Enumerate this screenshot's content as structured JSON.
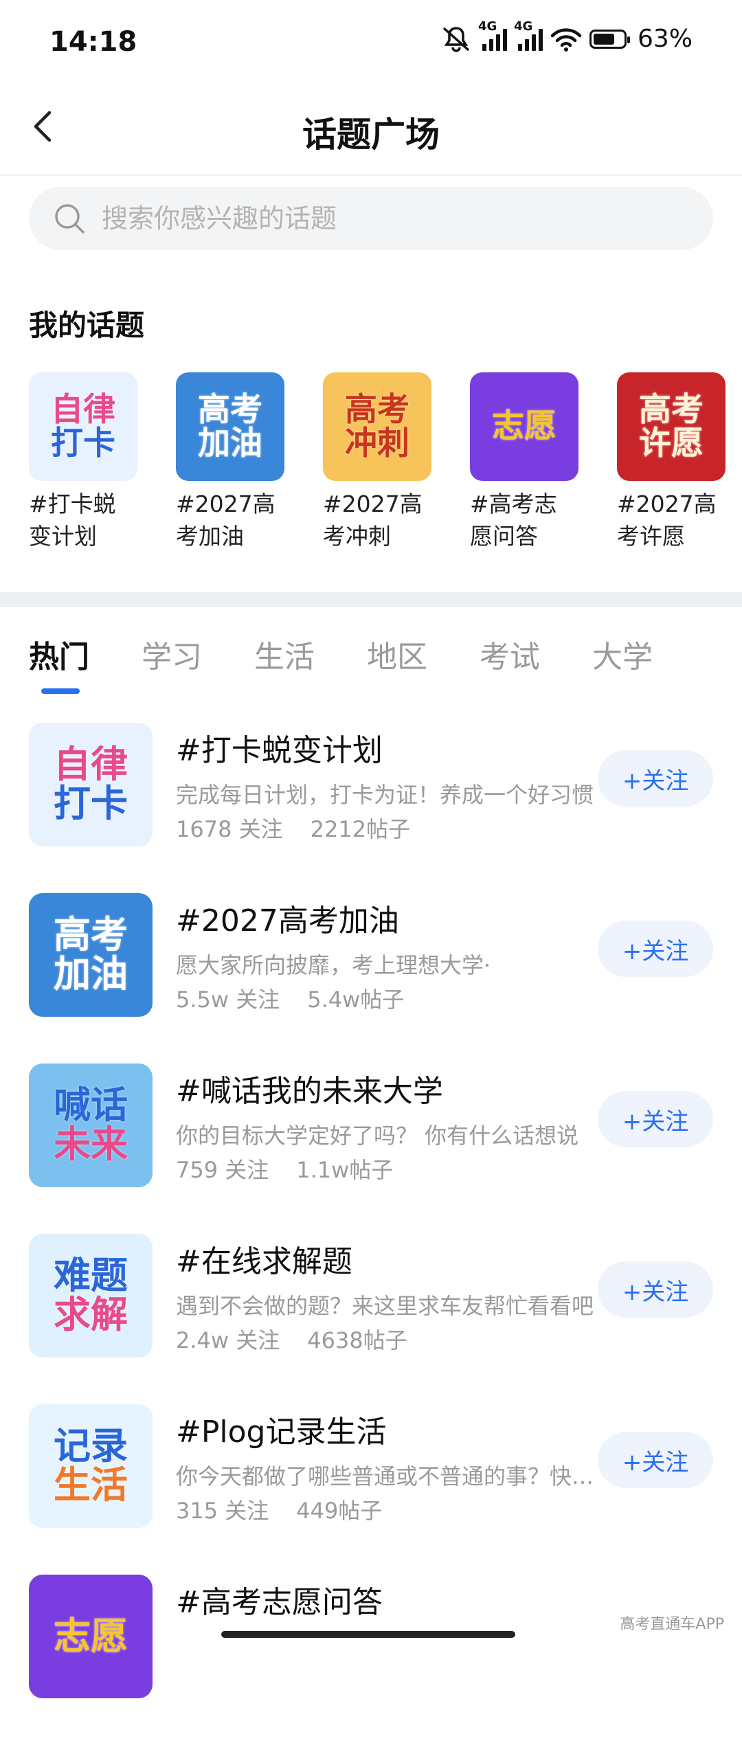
{
  "status_bar": {
    "time": "14:18",
    "network1": "4G",
    "network2": "4G",
    "battery": "63%"
  },
  "header": {
    "title": "话题广场"
  },
  "search": {
    "placeholder": "搜索你感兴趣的话题"
  },
  "my_topics": {
    "title": "我的话题",
    "items": [
      {
        "label": "#打卡蜕变计划",
        "art_lines": [
          "自律",
          "打卡"
        ],
        "bg": "#e8f2ff",
        "fg1": "#e84a8a",
        "fg2": "#2a66d8"
      },
      {
        "label": "#2027高考加油",
        "art_lines": [
          "高考",
          "加油"
        ],
        "bg": "#3a86d8",
        "fg1": "#ffffff",
        "fg2": "#ffffff"
      },
      {
        "label": "#2027高考冲刺",
        "art_lines": [
          "高考",
          "冲刺"
        ],
        "bg": "#f6c45a",
        "fg1": "#c8341e",
        "fg2": "#c8341e"
      },
      {
        "label": "#高考志愿问答",
        "art_lines": [
          "志愿"
        ],
        "bg": "#7a3de0",
        "fg1": "#f6c430",
        "fg2": "#f6c430"
      },
      {
        "label": "#2027高考许愿",
        "art_lines": [
          "高考",
          "许愿"
        ],
        "bg": "#c8252a",
        "fg1": "#fff3d6",
        "fg2": "#fff3d6"
      }
    ]
  },
  "tabs": [
    "热门",
    "学习",
    "生活",
    "地区",
    "考试",
    "大学"
  ],
  "topics": [
    {
      "name": "#打卡蜕变计划",
      "desc": "完成每日计划，打卡为证！养成一个好习惯",
      "follows": "1678 关注",
      "posts": "2212帖子",
      "follow_label": "+关注",
      "art_lines": [
        "自律",
        "打卡"
      ],
      "bg": "#e8f2ff",
      "fg1": "#e84a8a",
      "fg2": "#2a66d8"
    },
    {
      "name": "#2027高考加油",
      "desc": "愿大家所向披靡，考上理想大学·",
      "follows": "5.5w 关注",
      "posts": "5.4w帖子",
      "follow_label": "+关注",
      "art_lines": [
        "高考",
        "加油"
      ],
      "bg": "#3a86d8",
      "fg1": "#ffffff",
      "fg2": "#ffffff"
    },
    {
      "name": "#喊话我的未来大学",
      "desc": "你的目标大学定好了吗？ 你有什么话想说",
      "follows": "759 关注",
      "posts": "1.1w帖子",
      "follow_label": "+关注",
      "art_lines": [
        "喊话",
        "未来"
      ],
      "bg": "#7cc0f0",
      "fg1": "#2a66d8",
      "fg2": "#e84a8a"
    },
    {
      "name": "#在线求解题",
      "desc": "遇到不会做的题？来这里求车友帮忙看看吧",
      "follows": "2.4w 关注",
      "posts": "4638帖子",
      "follow_label": "+关注",
      "art_lines": [
        "难题",
        "求解"
      ],
      "bg": "#dff0ff",
      "fg1": "#2a66d8",
      "fg2": "#e84a8a"
    },
    {
      "name": "#Plog记录生活",
      "desc": "你今天都做了哪些普通或不普通的事？快来分享",
      "follows": "315 关注",
      "posts": "449帖子",
      "follow_label": "+关注",
      "art_lines": [
        "记录",
        "生活"
      ],
      "bg": "#e6f4ff",
      "fg1": "#2a66d8",
      "fg2": "#f07a2a"
    },
    {
      "name": "#高考志愿问答",
      "desc": "",
      "follows": "",
      "posts": "",
      "follow_label": "",
      "art_lines": [
        "志愿"
      ],
      "bg": "#7a3de0",
      "fg1": "#f6c430",
      "fg2": "#f6c430"
    }
  ],
  "watermark": "高考直通车APP"
}
